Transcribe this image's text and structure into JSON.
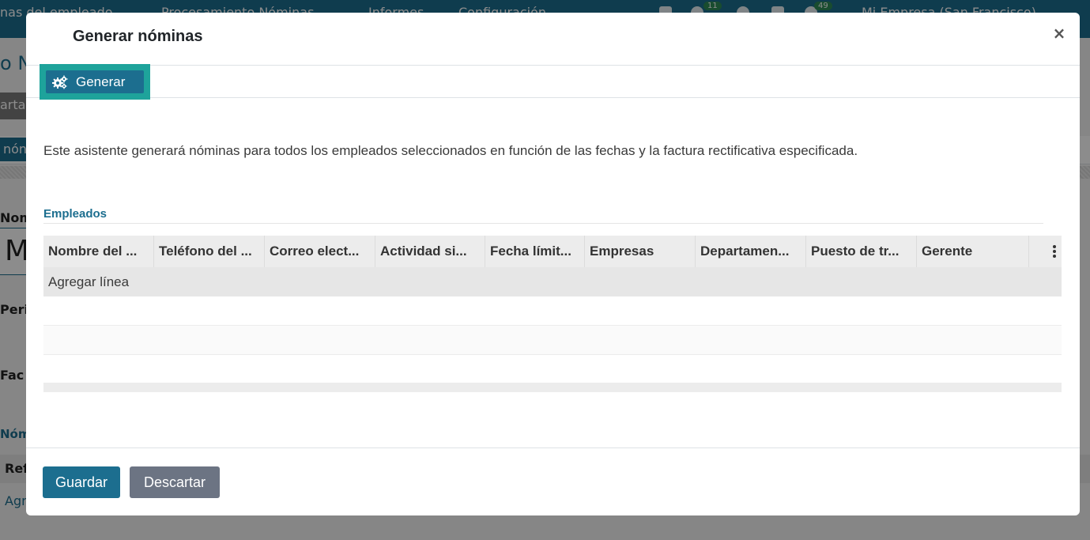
{
  "background": {
    "topbar": {
      "nav_items": [
        "nas del empleado",
        "Procesamiento Nóminas",
        "Informes",
        "Configuración"
      ],
      "badge_messages": "11",
      "badge_activities": "49",
      "company": "Mi Empresa (San Francisco)"
    },
    "crumb": "o N",
    "graybtn": "arta",
    "tab": "nón",
    "labels": [
      "Nom",
      "Peri",
      "Fac"
    ],
    "bigfield": "M",
    "section": "Nóm",
    "table_head": "Ref",
    "add_line": "Agr"
  },
  "modal": {
    "title": "Generar nóminas",
    "close_symbol": "×",
    "generate_label": "Generar",
    "description": "Este asistente generará nóminas para todos los empleados seleccionados en función de las fechas y la factura rectificativa especificada.",
    "section_title": "Empleados",
    "columns": [
      "Nombre del ...",
      "Teléfono del ...",
      "Correo elect...",
      "Actividad si...",
      "Fecha límit...",
      "Empresas",
      "Departamen...",
      "Puesto de tr...",
      "Gerente"
    ],
    "add_line": "Agregar línea",
    "save_label": "Guardar",
    "discard_label": "Descartar"
  },
  "colors": {
    "primary": "#1c6e8f",
    "highlight": "#1ea39b",
    "secondary": "#6c7483"
  }
}
